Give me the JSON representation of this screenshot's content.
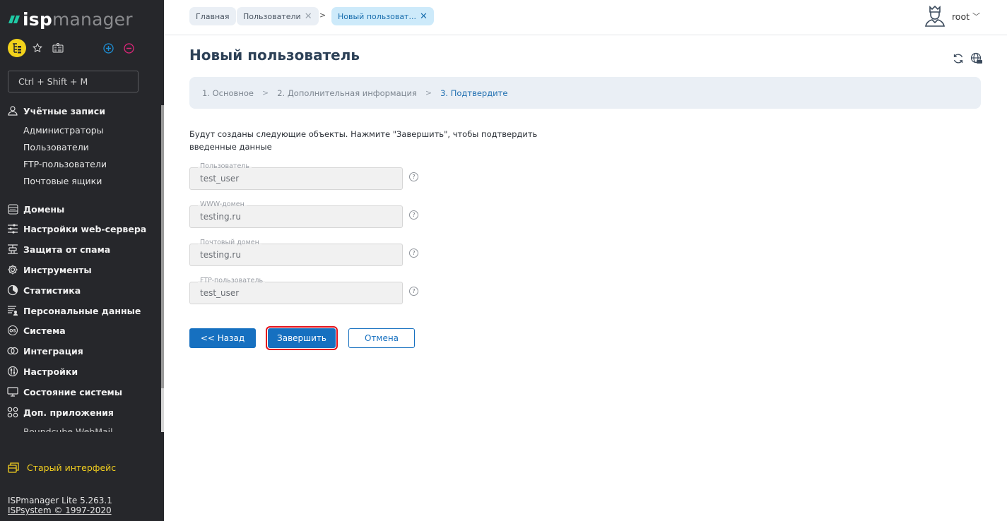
{
  "sidebar": {
    "logo": {
      "part1": "isp",
      "part2": "manager"
    },
    "search": {
      "placeholder": "Ctrl + Shift + M"
    },
    "groups": [
      {
        "label": "Учётные записи",
        "icon": "user-accounts-icon",
        "items": [
          "Администраторы",
          "Пользователи",
          "FTP-пользователи",
          "Почтовые ящики"
        ]
      },
      {
        "label": "Домены",
        "icon": "domains-icon"
      },
      {
        "label": "Настройки web-сервера",
        "icon": "sliders-icon"
      },
      {
        "label": "Защита от спама",
        "icon": "spam-protection-icon"
      },
      {
        "label": "Инструменты",
        "icon": "gear-icon"
      },
      {
        "label": "Статистика",
        "icon": "pie-chart-icon"
      },
      {
        "label": "Персональные данные",
        "icon": "personal-data-icon"
      },
      {
        "label": "Система",
        "icon": "os-icon"
      },
      {
        "label": "Интеграция",
        "icon": "integration-icon"
      },
      {
        "label": "Настройки",
        "icon": "settings-icon"
      },
      {
        "label": "Состояние системы",
        "icon": "monitor-icon"
      },
      {
        "label": "Доп. приложения",
        "icon": "apps-icon",
        "items": [
          "Roundcube WebMail"
        ]
      }
    ],
    "old_interface": "Старый интерфейс",
    "version": "ISPmanager Lite 5.263.1",
    "copyright": "ISPsystem © 1997-2020",
    "colors": {
      "background": "#26272b",
      "accent_yellow": "#f2d21b",
      "logo_green": "#1fc9a5"
    }
  },
  "header": {
    "breadcrumbs": [
      {
        "label": "Главная",
        "closable": false
      },
      {
        "label": "Пользователи",
        "closable": true
      },
      {
        "label": "Новый пользоват...",
        "closable": true,
        "active": true
      }
    ],
    "separator": ">",
    "user": {
      "name": "root"
    }
  },
  "page": {
    "title": "Новый пользователь",
    "steps": [
      {
        "label": "1. Основное",
        "current": false
      },
      {
        "label": "2. Дополнительная информация",
        "current": false
      },
      {
        "label": "3. Подтвердите",
        "current": true
      }
    ],
    "note": "Будут созданы следующие объекты. Нажмите \"Завершить\", чтобы подтвердить введенные данные",
    "fields": [
      {
        "label": "Пользователь",
        "value": "test_user"
      },
      {
        "label": "WWW-домен",
        "value": "testing.ru"
      },
      {
        "label": "Почтовый домен",
        "value": "testing.ru"
      },
      {
        "label": "FTP-пользователь",
        "value": "test_user"
      }
    ],
    "help_glyph": "?",
    "buttons": {
      "back": "<< Назад",
      "finish": "Завершить",
      "cancel": "Отмена"
    },
    "colors": {
      "primary": "#1670c0",
      "highlight": "#e3101a",
      "title": "#2d4157"
    }
  }
}
